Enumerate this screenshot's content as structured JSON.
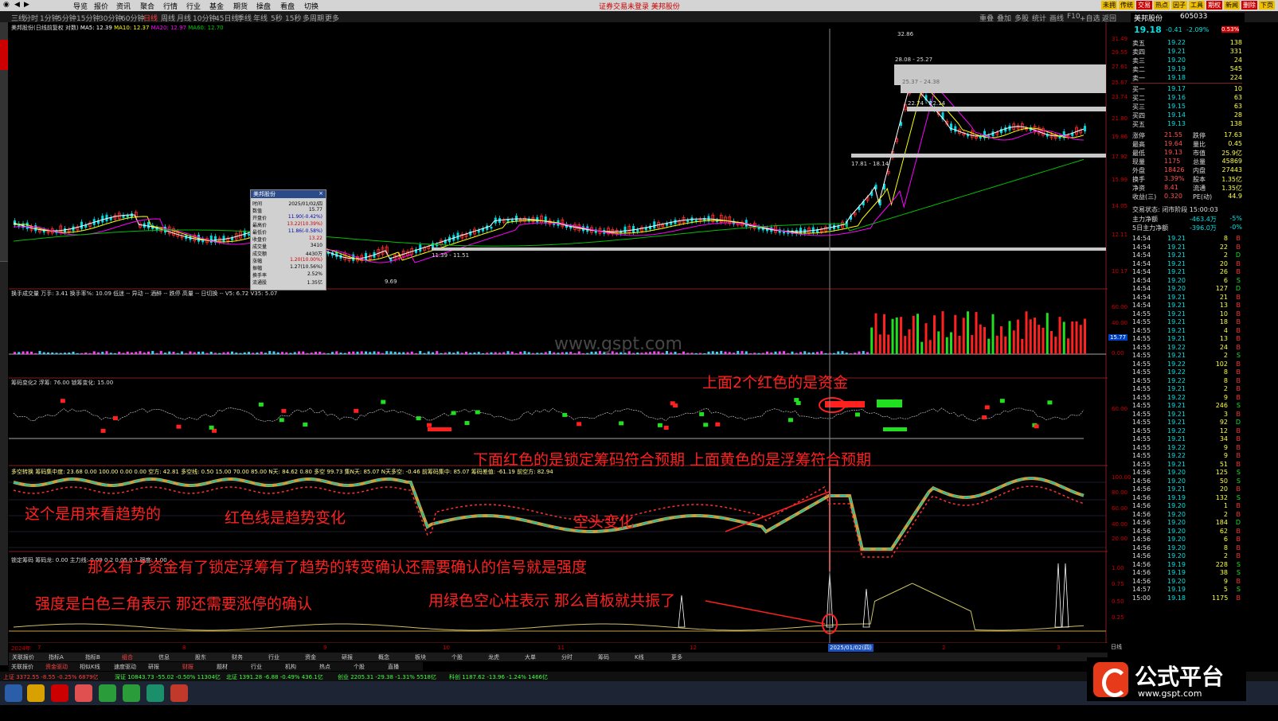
{
  "menubar": {
    "items": [
      "导览",
      "报价",
      "资讯",
      "聚合",
      "行情",
      "行业",
      "基金",
      "期货",
      "操盘",
      "看盘",
      "切换"
    ],
    "center_text": "证券交易未登录    美邦股份",
    "right_buttons": [
      "未拥",
      "传统",
      "交易",
      "热点",
      "因子",
      "工具",
      "期权",
      "新闻",
      "删除",
      "下页"
    ]
  },
  "toolbar": {
    "items": [
      "三线",
      "分时",
      "1分钟",
      "5分钟",
      "15分钟",
      "30分钟",
      "60分钟",
      "日线",
      "周线",
      "月线",
      "10分钟",
      "45日线",
      "季线",
      "年线",
      "5秒",
      "15秒",
      "多周期",
      "更多"
    ],
    "right_items": [
      "重叠",
      "叠加",
      "多股",
      "统计",
      "画线",
      "F10",
      "+自选",
      "返回"
    ]
  },
  "chart": {
    "stock_title": "美邦股份(日线前复权 对数)",
    "ma_legend": [
      {
        "label": "MA5: 12.39",
        "color": "#ffffff"
      },
      {
        "label": "MA10: 12.37",
        "color": "#ffff00"
      },
      {
        "label": "MA20: 12.97",
        "color": "#ff00ff"
      },
      {
        "label": "MA60: 12.70",
        "color": "#00c000"
      }
    ],
    "price_axis": [
      "31.49",
      "29.55",
      "27.61",
      "25.67",
      "23.74",
      "21.80",
      "19.86",
      "17.92",
      "15.99",
      "14.05",
      "12.11",
      "10.17"
    ],
    "price_labels": [
      {
        "text": "32.86"
      },
      {
        "text": "28.08 - 25.27"
      },
      {
        "text": "25.37 - 24.38"
      },
      {
        "text": "22.74 - 22.14"
      },
      {
        "text": "17.81 - 18.14"
      },
      {
        "text": "11.39 - 11.51"
      },
      {
        "text": "9.69"
      }
    ],
    "vol_legend": "换手成交量 万手: 3.41  换手率%: 10.09  低迷 --  异动 --  酒醉 --  跌停  高量  --  日切换 --  V5: 6.72  V35: 5.07",
    "vol_axis": [
      "60.00",
      "40.00",
      "20.00",
      "0.00"
    ],
    "vol_highlight": "15.77",
    "chip_legend": "筹码变化2  浮筹: 76.00  锁筹变化: 15.00",
    "chip_axis": [
      "60.00"
    ],
    "trend_legend": "多空转换  筹码集中度: 23.68  0.00  100.00  0.00  0.00  空方: 42.81  多空线: 0.50  15.00  70.00  85.00  N天: 84.62  0.80  多空  99.73  集N天: 85.07  N天多空: -0.46  前筹码集中: 85.07  筹码差值: -61.19  前空方: 82.94",
    "trend_axis": [
      "100.00",
      "80.00",
      "60.00",
      "40.00",
      "20.00"
    ],
    "lock_legend": "锁定筹码  筹码龙: 0.00  主力线: 0.09  0.2  0.05  0.1  强度: 1.00",
    "lock_axis": [
      "1.00",
      "0.75",
      "0.50",
      "0.25"
    ],
    "date_axis": [
      {
        "label": "2024年"
      },
      {
        "label": "7"
      },
      {
        "label": "8"
      },
      {
        "label": "9"
      },
      {
        "label": "10"
      },
      {
        "label": "11"
      },
      {
        "label": "12"
      },
      {
        "label": "2025/01/02(四)"
      },
      {
        "label": "2"
      },
      {
        "label": "3"
      }
    ],
    "watermark": "www.gspt.com",
    "crosshair_label": "15.77",
    "axis_right_label": "日线"
  },
  "popup": {
    "title": "美邦股份",
    "rows": [
      {
        "k": "时间",
        "v": "2025/01/02/四",
        "c": "#000"
      },
      {
        "k": "数值",
        "v": "15.77",
        "c": "#000"
      },
      {
        "k": "开盘价",
        "v": "11.90(-0.42%)",
        "c": "#00a"
      },
      {
        "k": "最高价",
        "v": "13.22(10.39%)",
        "c": "#c00"
      },
      {
        "k": "最低价",
        "v": "11.86(-0.58%)",
        "c": "#00a"
      },
      {
        "k": "收盘价",
        "v": "13.22",
        "c": "#c00"
      },
      {
        "k": "成交量",
        "v": "3410",
        "c": "#000"
      },
      {
        "k": "成交额",
        "v": "4430万",
        "c": "#000"
      },
      {
        "k": "涨幅",
        "v": "1.20(10.00%)",
        "c": "#c00"
      },
      {
        "k": "振幅",
        "v": "1.27(10.56%)",
        "c": "#000"
      },
      {
        "k": "换手率",
        "v": "2.52%",
        "c": "#000"
      },
      {
        "k": "流通股",
        "v": "1.35亿",
        "c": "#000"
      }
    ]
  },
  "annotations": [
    {
      "text": "上面2个红色的是资金"
    },
    {
      "text": "下面红色的是锁定筹码符合预期  上面黄色的是浮筹符合预期"
    },
    {
      "text": "这个是用来看趋势的"
    },
    {
      "text": "红色线是趋势变化"
    },
    {
      "text": "空头变化"
    },
    {
      "text": "那么有了资金有了锁定浮筹有了趋势的转变确认还需要确认的信号就是强度"
    },
    {
      "text": "强度是白色三角表示    那还需要涨停的确认"
    },
    {
      "text": "用绿色空心柱表示  那么首板就共振了"
    }
  ],
  "quote": {
    "name": "美邦股份",
    "code": "605033",
    "price": "19.18",
    "change": "-0.41",
    "pct": "-2.09%",
    "extra": "0.53%",
    "asks": [
      {
        "label": "卖五",
        "price": "19.22",
        "vol": "138"
      },
      {
        "label": "卖四",
        "price": "19.21",
        "vol": "331"
      },
      {
        "label": "卖三",
        "price": "19.20",
        "vol": "24"
      },
      {
        "label": "卖二",
        "price": "19.19",
        "vol": "545"
      },
      {
        "label": "卖一",
        "price": "19.18",
        "vol": "224"
      }
    ],
    "bids": [
      {
        "label": "买一",
        "price": "19.17",
        "vol": "10"
      },
      {
        "label": "买二",
        "price": "19.16",
        "vol": "63"
      },
      {
        "label": "买三",
        "price": "19.15",
        "vol": "63"
      },
      {
        "label": "买四",
        "price": "19.14",
        "vol": "28"
      },
      {
        "label": "买五",
        "price": "19.13",
        "vol": "138"
      }
    ],
    "stats": [
      {
        "l1": "涨停",
        "v1": "21.55",
        "l2": "跌停",
        "v2": "17.63"
      },
      {
        "l1": "最高",
        "v1": "19.64",
        "l2": "量比",
        "v2": "0.45"
      },
      {
        "l1": "最低",
        "v1": "19.13",
        "l2": "市值",
        "v2": "25.9亿"
      },
      {
        "l1": "现量",
        "v1": "1175",
        "l2": "总量",
        "v2": "45869"
      },
      {
        "l1": "外盘",
        "v1": "18426",
        "l2": "内盘",
        "v2": "27443"
      },
      {
        "l1": "换手",
        "v1": "3.39%",
        "l2": "股本",
        "v2": "1.35亿"
      },
      {
        "l1": "净资",
        "v1": "8.41",
        "l2": "流通",
        "v2": "1.35亿"
      },
      {
        "l1": "收益(三)",
        "v1": "0.320",
        "l2": "PE(动)",
        "v2": "44.9"
      }
    ],
    "session": "交易状态: 闭市阶段  15:00:03",
    "flows": [
      {
        "label": "主力净额",
        "value": "-463.4万",
        "pct": "-5%"
      },
      {
        "label": "5日主力净额",
        "value": "-396.0万",
        "pct": "-0%"
      }
    ]
  },
  "ticks": [
    [
      "14:54",
      "19.21",
      "8",
      "B"
    ],
    [
      "14:54",
      "19.21",
      "22",
      "B"
    ],
    [
      "14:54",
      "19.21",
      "2",
      "D"
    ],
    [
      "14:54",
      "19.21",
      "20",
      "B"
    ],
    [
      "14:54",
      "19.21",
      "26",
      "B"
    ],
    [
      "14:54",
      "19.20",
      "6",
      "S"
    ],
    [
      "14:54",
      "19.20",
      "127",
      "D"
    ],
    [
      "14:54",
      "19.21",
      "21",
      "B"
    ],
    [
      "14:54",
      "19.21",
      "13",
      "B"
    ],
    [
      "14:55",
      "19.21",
      "10",
      "B"
    ],
    [
      "14:55",
      "19.21",
      "18",
      "B"
    ],
    [
      "14:55",
      "19.21",
      "4",
      "B"
    ],
    [
      "14:55",
      "19.21",
      "13",
      "B"
    ],
    [
      "14:55",
      "19.22",
      "24",
      "B"
    ],
    [
      "14:55",
      "19.21",
      "2",
      "S"
    ],
    [
      "14:55",
      "19.22",
      "102",
      "B"
    ],
    [
      "14:55",
      "19.22",
      "8",
      "B"
    ],
    [
      "14:55",
      "19.22",
      "8",
      "B"
    ],
    [
      "14:55",
      "19.21",
      "2",
      "B"
    ],
    [
      "14:55",
      "19.22",
      "9",
      "B"
    ],
    [
      "14:55",
      "19.21",
      "246",
      "S"
    ],
    [
      "14:55",
      "19.21",
      "3",
      "B"
    ],
    [
      "14:55",
      "19.21",
      "92",
      "D"
    ],
    [
      "14:55",
      "19.22",
      "12",
      "B"
    ],
    [
      "14:55",
      "19.21",
      "34",
      "B"
    ],
    [
      "14:55",
      "19.22",
      "9",
      "B"
    ],
    [
      "14:55",
      "19.22",
      "9",
      "B"
    ],
    [
      "14:55",
      "19.21",
      "51",
      "B"
    ],
    [
      "14:56",
      "19.20",
      "125",
      "S"
    ],
    [
      "14:56",
      "19.20",
      "50",
      "S"
    ],
    [
      "14:56",
      "19.21",
      "20",
      "B"
    ],
    [
      "14:56",
      "19.19",
      "132",
      "S"
    ],
    [
      "14:56",
      "19.20",
      "1",
      "B"
    ],
    [
      "14:56",
      "19.20",
      "2",
      "B"
    ],
    [
      "14:56",
      "19.20",
      "184",
      "D"
    ],
    [
      "14:56",
      "19.20",
      "62",
      "B"
    ],
    [
      "14:56",
      "19.20",
      "6",
      "B"
    ],
    [
      "14:56",
      "19.20",
      "8",
      "B"
    ],
    [
      "14:56",
      "19.20",
      "2",
      "B"
    ],
    [
      "14:56",
      "19.19",
      "228",
      "S"
    ],
    [
      "14:56",
      "19.19",
      "38",
      "S"
    ],
    [
      "14:56",
      "19.20",
      "9",
      "B"
    ],
    [
      "14:57",
      "19.19",
      "5",
      "S"
    ],
    [
      "15:00",
      "19.18",
      "1175",
      "B"
    ]
  ],
  "bottom_tabs": [
    "关联报价",
    "指标A",
    "指标B",
    "组合",
    "信息",
    "股东",
    "财务",
    "行业",
    "资金",
    "研报",
    "概念",
    "板块",
    "个股",
    "龙虎",
    "大单",
    "分时",
    "筹码",
    "K线",
    "更多"
  ],
  "tabs2": [
    "关联报价",
    "资金驱动",
    "相似K线",
    "速度驱动",
    "研报",
    "财报",
    "题材",
    "行业",
    "机构",
    "热点",
    "个股",
    "直播"
  ],
  "status": [
    {
      "t": "上证 3372.55  -8.55  -0.25%  6879亿",
      "c": "#ff4040"
    },
    {
      "t": "深证 10843.73  -55.02  -0.50%  11304亿",
      "c": "#40ff40"
    },
    {
      "t": "北证 1391.28  -6.88  -0.49%  436.1亿",
      "c": "#40ff40"
    },
    {
      "t": "创业 2205.31  -29.38  -1.31%  5518亿",
      "c": "#40ff40"
    },
    {
      "t": "科创 1187.62  -13.96  -1.24%  1466亿",
      "c": "#40ff40"
    }
  ],
  "watermark_logo": {
    "text": "公式平台",
    "url_text": "www.gspt.com"
  },
  "colors": {
    "up": "#ff3030",
    "down": "#00e0e0",
    "ma5": "#ffffff",
    "ma10": "#ffff00",
    "ma20": "#ff00ff",
    "ma60": "#00c000",
    "annotation": "#ff2020"
  }
}
